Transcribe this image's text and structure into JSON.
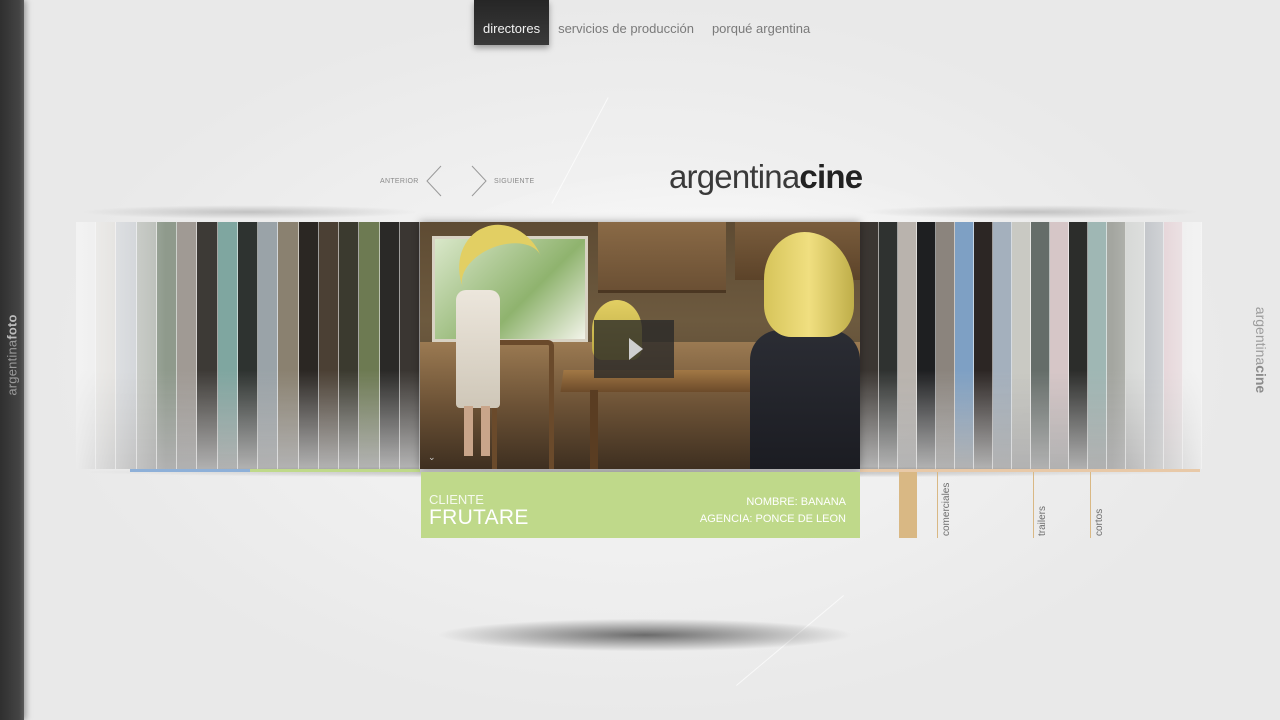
{
  "nav": {
    "items": [
      {
        "label": "directores",
        "active": true
      },
      {
        "label": "servicios de producción",
        "active": false
      },
      {
        "label": "porqué argentina",
        "active": false
      }
    ]
  },
  "side": {
    "left_label_light": "argentina",
    "left_label_bold": "foto",
    "right_label_light": "argentina",
    "right_label_bold": "cine"
  },
  "logo": {
    "light": "argentina",
    "bold": "cine"
  },
  "pager": {
    "prev": "ANTERIOR",
    "next": "SIGUIENTE"
  },
  "video": {
    "play_icon": "play-icon"
  },
  "info": {
    "cliente_label": "CLIENTE",
    "cliente_name": "FRUTARE",
    "nombre": "NOMBRE: BANANA",
    "agencia": "AGENCIA: PONCE DE LEON",
    "color": "#bfd98a"
  },
  "categories": [
    {
      "label": "comerciales"
    },
    {
      "label": "trailers"
    },
    {
      "label": "cortos"
    }
  ],
  "colors": {
    "accent_green": "#bfd98a",
    "accent_tan": "#d9b884",
    "nav_active_bg": "#2f2f2f"
  },
  "strip": {
    "left_colors": [
      "#e4e4e4",
      "#d8d5d0",
      "#c7cbd0",
      "#b8bcb6",
      "#8f9a8c",
      "#a09a94",
      "#3d3a36",
      "#7fa6a0",
      "#2e3330",
      "#9aa3a8",
      "#8a8170",
      "#2b2723",
      "#4b4034",
      "#3b3a2f",
      "#6d7a52",
      "#2a2927",
      "#3a3632"
    ],
    "right_colors": [
      "#3b3632",
      "#2f3230",
      "#b9b3ad",
      "#1e1f21",
      "#8b847d",
      "#7ea0c4",
      "#2c2624",
      "#a4b0bd",
      "#c9c9c3",
      "#656d69",
      "#d6c6c7",
      "#2c2d2b",
      "#9fb7b4",
      "#a4a6a0",
      "#d2d4d2",
      "#aeb2b8",
      "#d8b9c0",
      "#e6e6e6"
    ]
  }
}
